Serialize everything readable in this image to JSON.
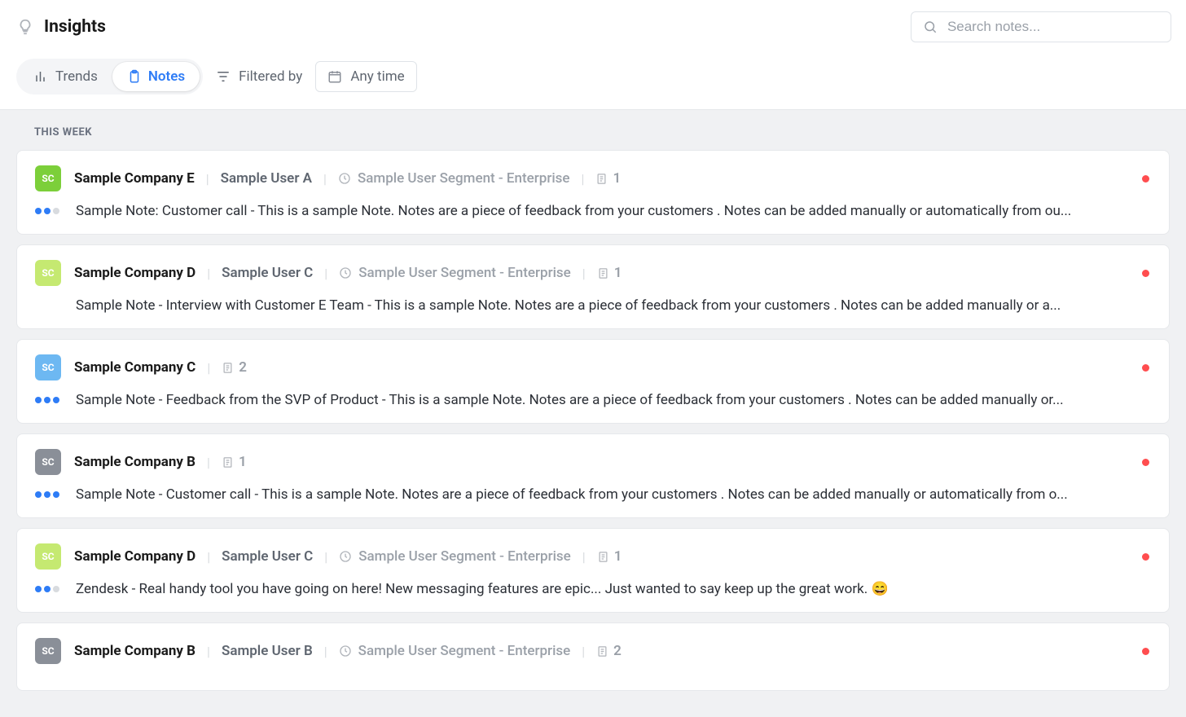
{
  "header": {
    "title": "Insights",
    "search_placeholder": "Search notes..."
  },
  "toolbar": {
    "tabs": {
      "trends": "Trends",
      "notes": "Notes"
    },
    "filtered_by": "Filtered by",
    "any_time": "Any time"
  },
  "section_label": "THIS WEEK",
  "notes": [
    {
      "avatar_text": "SC",
      "avatar_bg": "#7ccf3a",
      "company": "Sample Company E",
      "user": "Sample User A",
      "segment": "Sample User Segment - Enterprise",
      "count": "1",
      "dots": [
        "#2e7cf6",
        "#2e7cf6",
        "#d8dbdf"
      ],
      "text": "Sample Note: Customer call - This is a sample Note. Notes are a piece of feedback from your customers . Notes can be added manually or automatically from ou..."
    },
    {
      "avatar_text": "SC",
      "avatar_bg": "#c5e971",
      "company": "Sample Company D",
      "user": "Sample User C",
      "segment": "Sample User Segment - Enterprise",
      "count": "1",
      "dots": [],
      "text": "Sample Note - Interview with Customer E Team - This is a sample Note. Notes are a piece of feedback from your customers . Notes can be added manually or a..."
    },
    {
      "avatar_text": "SC",
      "avatar_bg": "#6db8f2",
      "company": "Sample Company C",
      "user": "",
      "segment": "",
      "count": "2",
      "dots": [
        "#2e7cf6",
        "#2e7cf6",
        "#2e7cf6"
      ],
      "text": "Sample Note - Feedback from the SVP of Product - This is a sample Note. Notes are a piece of feedback from your customers . Notes can be added manually or..."
    },
    {
      "avatar_text": "SC",
      "avatar_bg": "#8a8f98",
      "company": "Sample Company B",
      "user": "",
      "segment": "",
      "count": "1",
      "dots": [
        "#2e7cf6",
        "#2e7cf6",
        "#2e7cf6"
      ],
      "text": "Sample Note - Customer call - This is a sample Note. Notes are a piece of feedback from your customers . Notes can be added manually or automatically from o..."
    },
    {
      "avatar_text": "SC",
      "avatar_bg": "#c5e971",
      "company": "Sample Company D",
      "user": "Sample User C",
      "segment": "Sample User Segment - Enterprise",
      "count": "1",
      "dots": [
        "#2e7cf6",
        "#2e7cf6",
        "#d8dbdf"
      ],
      "text": "Zendesk - Real handy tool you have going on here! New messaging features are epic... Just wanted to say keep up the great work. 😄"
    },
    {
      "avatar_text": "SC",
      "avatar_bg": "#8a8f98",
      "company": "Sample Company B",
      "user": "Sample User B",
      "segment": "Sample User Segment - Enterprise",
      "count": "2",
      "dots": [],
      "text": ""
    }
  ]
}
